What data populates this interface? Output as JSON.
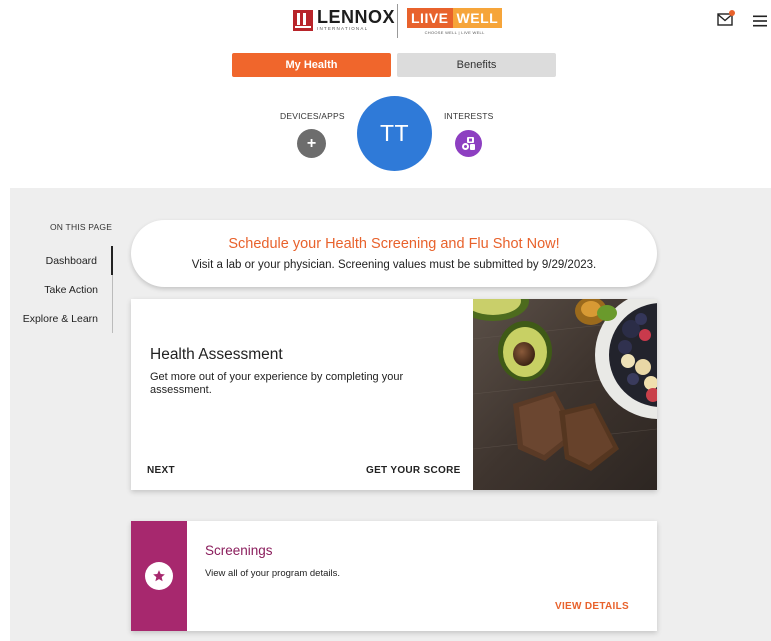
{
  "header": {
    "brand_primary": "LENNOX",
    "brand_primary_sub": "INTERNATIONAL",
    "brand_secondary_a": "LIIVE",
    "brand_secondary_b": "WELL",
    "brand_secondary_tag": "CHOOSE WELL | LIVE WELL",
    "mail_icon": "mail-icon",
    "menu_icon": "hamburger-menu-icon",
    "accent": "#e8622c"
  },
  "tabs": [
    {
      "label": "My Health",
      "active": true
    },
    {
      "label": "Benefits",
      "active": false
    }
  ],
  "profile": {
    "devices_label": "DEVICES/APPS",
    "devices_btn": "+",
    "avatar_initials": "TT",
    "avatar_color": "#2f7ad8",
    "interests_label": "INTERESTS",
    "interests_color": "#8d3fc1"
  },
  "on_this_page": {
    "label": "ON THIS PAGE",
    "items": [
      {
        "label": "Dashboard",
        "active": true
      },
      {
        "label": "Take Action",
        "active": false
      },
      {
        "label": "Explore & Learn",
        "active": false
      }
    ]
  },
  "banner": {
    "title": "Schedule your Health Screening and Flu Shot Now!",
    "subtitle": "Visit a lab or your physician. Screening values must be submitted by 9/29/2023."
  },
  "health_assessment": {
    "title": "Health Assessment",
    "description": "Get more out of your experience by completing your assessment.",
    "next_label": "NEXT",
    "score_label": "GET YOUR SCORE"
  },
  "screenings": {
    "title": "Screenings",
    "description": "View all of your program details.",
    "link_label": "VIEW DETAILS",
    "strip_color": "#a7286e"
  }
}
